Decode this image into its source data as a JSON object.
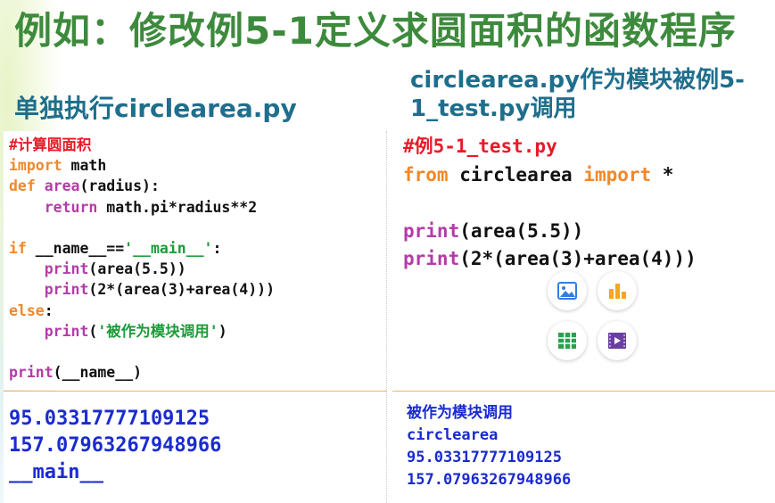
{
  "slide": {
    "title": "例如：修改例5-1定义求圆面积的函数程序",
    "left_heading_prefix": "单独执行",
    "left_heading_file": "circlearea.py",
    "right_heading_file": "circlearea.py",
    "right_heading_text1": "作为模块被例5-",
    "right_heading_file2": "1_test.py",
    "right_heading_text2": "调用"
  },
  "left_code": {
    "comment": "#计算圆面积",
    "import_kw": "import",
    "import_mod": " math",
    "def_kw": "def",
    "def_name": " area",
    "def_args": "(radius):",
    "return_kw": "return",
    "return_expr": " math.pi*radius**2",
    "if_kw": "if",
    "if_cond": " __name__==",
    "if_str": "'__main__'",
    "if_colon": ":",
    "print1_kw": "print",
    "print1_args": "(area(5.5))",
    "print2_kw": "print",
    "print2_args": "(2*(area(3)+area(4)))",
    "else_kw": "else",
    "else_colon": ":",
    "print3_kw": "print",
    "print3_paren_open": "(",
    "print3_str": "'被作为模块调用'",
    "print3_paren_close": ")",
    "print4_kw": "print",
    "print4_args": "(__name__)"
  },
  "right_code": {
    "comment": "#例5-1_test.py",
    "from_kw": "from",
    "from_mod": " circlearea ",
    "import_kw": "import",
    "import_star": " *",
    "print1_kw": "print",
    "print1_args": "(area(5.5))",
    "print2_kw": "print",
    "print2_args": "(2*(area(3)+area(4)))"
  },
  "left_output": {
    "lines": [
      "95.03317777109125",
      "157.07963267948966",
      "__main__"
    ]
  },
  "right_output": {
    "lines": [
      "被作为模块调用",
      "circlearea",
      "95.03317777109125",
      "157.07963267948966"
    ]
  },
  "icons": [
    "image-icon",
    "bar-chart-icon",
    "table-icon",
    "video-icon"
  ],
  "colors": {
    "title_green": "#3d8a3d",
    "heading_blue": "#1f6e8c",
    "keyword_orange": "#f0882a",
    "function_purple": "#b43ca8",
    "string_green": "#1f9a3a",
    "comment_red": "#e81a28",
    "output_blue": "#1a2bd0"
  }
}
